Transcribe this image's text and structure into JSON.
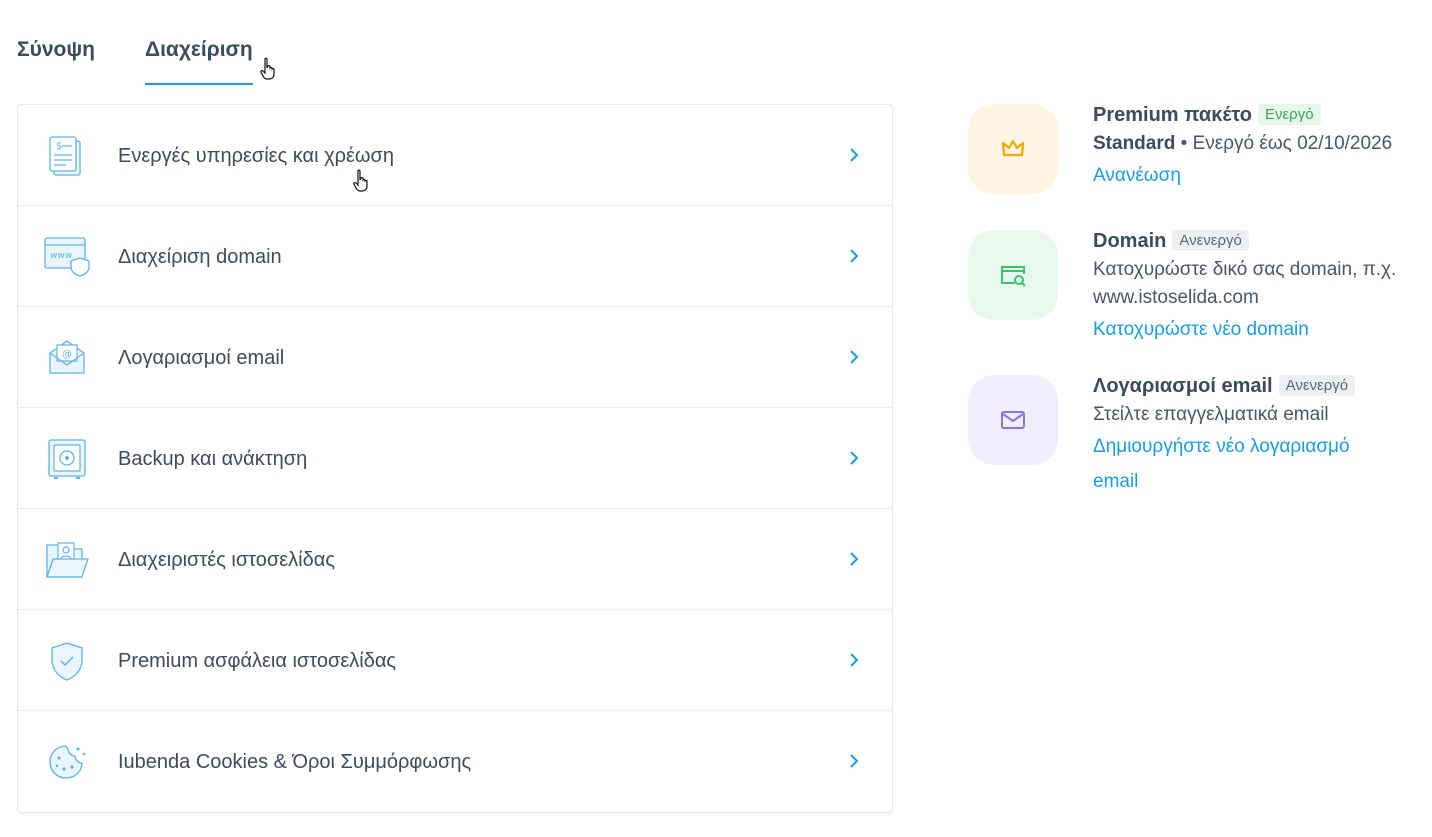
{
  "tabs": [
    {
      "label": "Σύνοψη",
      "active": false
    },
    {
      "label": "Διαχείριση",
      "active": true
    }
  ],
  "menu": [
    {
      "label": "Ενεργές υπηρεσίες και χρέωση",
      "icon": "invoice-icon"
    },
    {
      "label": "Διαχείριση domain",
      "icon": "www-shield-icon"
    },
    {
      "label": "Λογαριασμοί email",
      "icon": "envelope-icon"
    },
    {
      "label": "Backup και ανάκτηση",
      "icon": "safe-icon"
    },
    {
      "label": "Διαχειριστές ιστοσελίδας",
      "icon": "folder-user-icon"
    },
    {
      "label": "Premium ασφάλεια ιστοσελίδας",
      "icon": "shield-check-icon"
    },
    {
      "label": "Iubenda Cookies & Όροι Συμμόρφωσης",
      "icon": "cookie-icon"
    }
  ],
  "services": {
    "premium": {
      "name": "Premium πακέτο",
      "badge": "Ενεργό",
      "plan": "Standard",
      "status_text": " • Ενεργό έως 02/10/2026",
      "link": "Ανανέωση",
      "icon": "crown-icon"
    },
    "domain": {
      "name": "Domain",
      "badge": "Ανενεργό",
      "description": "Κατοχυρώστε δικό σας domain, π.χ. www.istoselida.com",
      "link": "Κατοχυρώστε νέο domain",
      "icon": "domain-search-icon"
    },
    "email": {
      "name": "Λογαριασμοί email",
      "badge": "Ανενεργό",
      "description": "Στείλτε επαγγελματικά email",
      "link": "Δημιουργήστε νέο λογαριασμό email",
      "icon": "mail-icon"
    }
  },
  "colors": {
    "accent": "#1a9be6",
    "text": "#3e4a5e",
    "active_badge": "#3aa45a",
    "crown": "#f2a900",
    "domain_icon": "#3cc46a",
    "mail_icon": "#8b73f0"
  }
}
